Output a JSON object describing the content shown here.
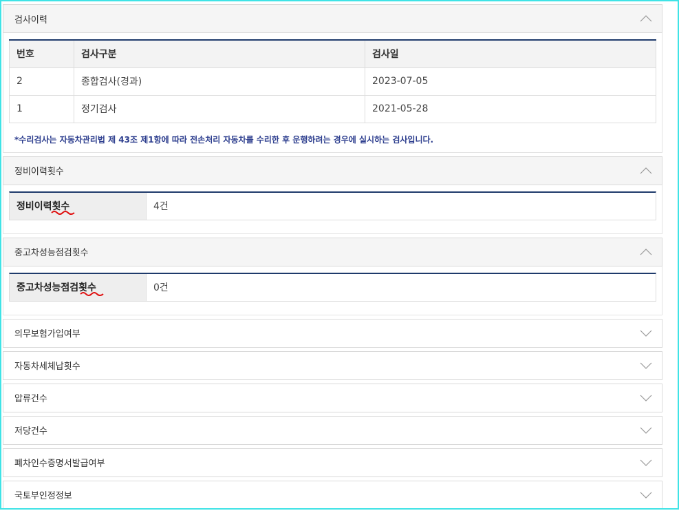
{
  "inspection_history": {
    "title": "검사이력",
    "columns": [
      "번호",
      "검사구분",
      "검사일"
    ],
    "rows": [
      {
        "no": "2",
        "type": "종합검사(경과)",
        "date": "2023-07-05"
      },
      {
        "no": "1",
        "type": "정기검사",
        "date": "2021-05-28"
      }
    ],
    "note": "*수리검사는 자동차관리법 제 43조 제1항에 따라 전손처리 자동차를 수리한 후 운행하려는 경우에 실시하는 검사입니다."
  },
  "maintenance": {
    "title": "정비이력횟수",
    "label": "정비이력횟수",
    "value": "4건"
  },
  "used_car_check": {
    "title": "중고차성능점검횟수",
    "label": "중고차성능점검횟수",
    "value": "0건"
  },
  "collapsed_sections": [
    "의무보험가입여부",
    "자동차세체납횟수",
    "압류건수",
    "저당건수",
    "폐차인수증명서발급여부",
    "국토부인정정보"
  ],
  "colors": {
    "accent_border": "#1e3a6b",
    "note_text": "#2e3f8f",
    "annotation_red": "#e01010",
    "frame": "#3fe3e6"
  }
}
